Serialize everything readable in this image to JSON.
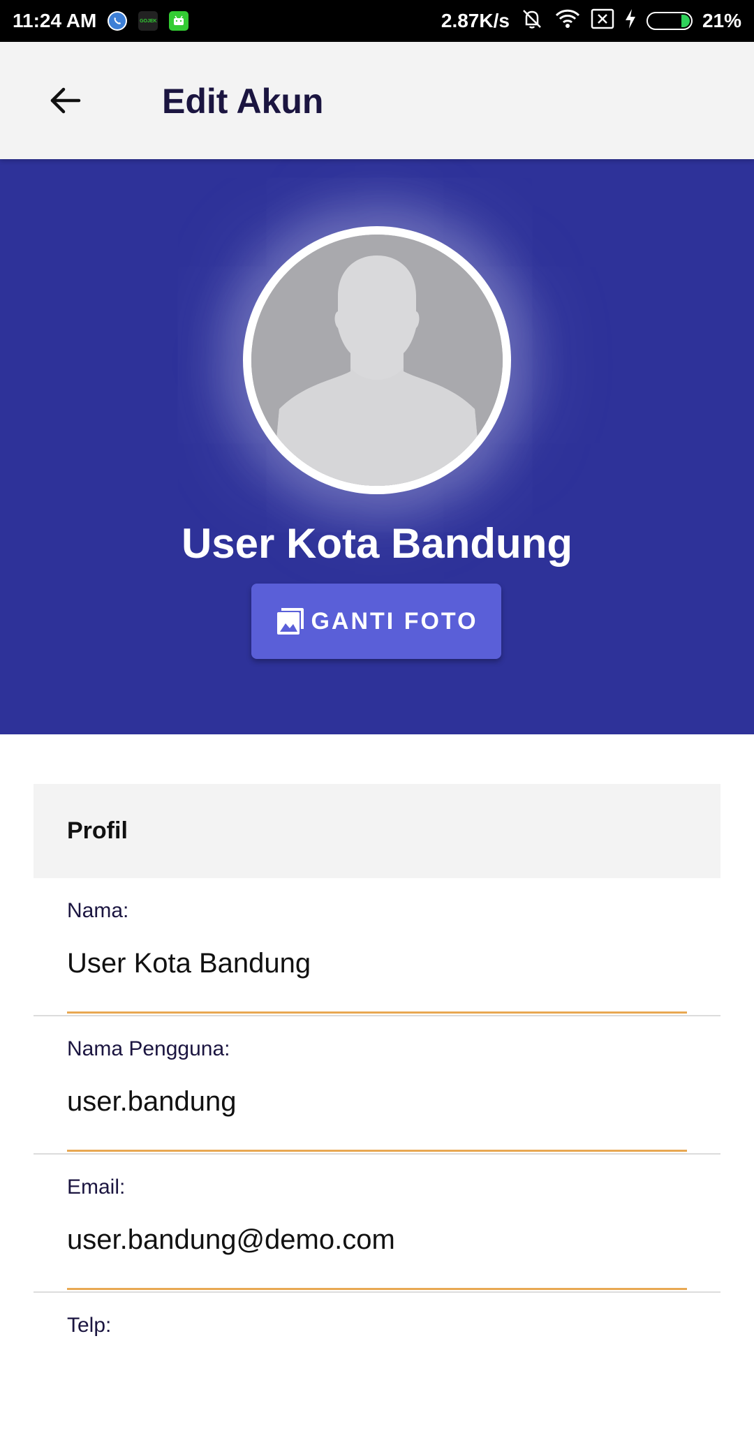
{
  "status_bar": {
    "time": "11:24 AM",
    "speed": "2.87K/s",
    "battery": "21%",
    "battery_level": 0.21,
    "gojek_label": "GOJEK",
    "icons": [
      "whatsapp-icon",
      "gojek-icon",
      "android-icon",
      "vibrate-off-icon",
      "wifi-icon",
      "no-sim-icon",
      "charging-icon",
      "battery-icon"
    ]
  },
  "app_bar": {
    "title": "Edit Akun"
  },
  "profile": {
    "name": "User Kota Bandung",
    "change_photo_label": "GANTI FOTO"
  },
  "form": {
    "section_title": "Profil",
    "fields": [
      {
        "label": "Nama:",
        "value": "User Kota Bandung"
      },
      {
        "label": "Nama Pengguna:",
        "value": "user.bandung"
      },
      {
        "label": "Email:",
        "value": "user.bandung@demo.com"
      },
      {
        "label": "Telp:",
        "value": ""
      }
    ]
  },
  "colors": {
    "hero_bg": "#2e3299",
    "button_bg": "#5a5fd8",
    "field_underline": "#e8a852",
    "app_bar_bg": "#f3f3f3"
  }
}
